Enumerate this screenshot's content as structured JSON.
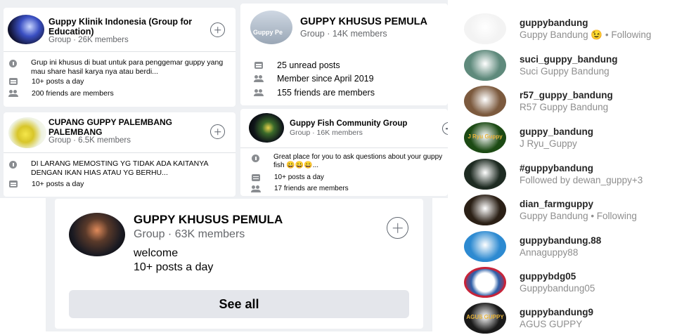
{
  "groups": [
    {
      "title": "Guppy Klinik Indonesia (Group for Education)",
      "subtitle": "Group · 26K members",
      "description": "Grup ini khusus di buat untuk para penggemar guppy yang mau share hasil karya nya atau berdi...",
      "posts": "10+ posts a day",
      "friends": "200 friends are members"
    },
    {
      "title": "GUPPY KHUSUS PEMULA",
      "subtitle": "Group · 14K members",
      "avatar_text": "Guppy Pe",
      "unread": "25 unread posts",
      "member_since": "Member since April 2019",
      "friends": "155 friends are members"
    },
    {
      "title": "CUPANG GUPPY PALEMBANG PALEMBANG",
      "subtitle": "Group · 6.5K members",
      "description": "DI LARANG MEMOSTING YG TIDAK ADA KAITANYA DENGAN IKAN HIAS ATAU YG BERHU...",
      "posts": "10+ posts a day"
    },
    {
      "title": "Guppy Fish Community Group",
      "subtitle": "Group · 16K members",
      "description": "Great place for you to ask questions about your guppy fish 😀😀😀...",
      "posts": "10+ posts a day",
      "friends": "17 friends are members"
    },
    {
      "title": "GUPPY KHUSUS PEMULA",
      "subtitle": "Group · 63K members",
      "description": "welcome",
      "posts": "10+ posts a day"
    }
  ],
  "see_all_label": "See all",
  "instagram_accounts": [
    {
      "username": "guppybandung",
      "name": "Guppy Bandung 😉 • Following",
      "avatar_color": "#f3f3f3"
    },
    {
      "username": "suci_guppy_bandung",
      "name": "Suci Guppy Bandung",
      "avatar_color": "#5f8a7c"
    },
    {
      "username": "r57_guppy_bandung",
      "name": "R57 Guppy Bandung",
      "avatar_color": "#7c5a3e"
    },
    {
      "username": "guppy_bandung",
      "name": "J Ryu_Guppy",
      "avatar_color": "#1c4a14",
      "avatar_text": "J Ryu Guppy"
    },
    {
      "username": "#guppybandung",
      "name": "Followed by dewan_guppy+3",
      "avatar_color": "#1e2b22"
    },
    {
      "username": "dian_farmguppy",
      "name": "Guppy Bandung • Following",
      "avatar_color": "#2b2016"
    },
    {
      "username": "guppybandung.88",
      "name": "Annaguppy88",
      "avatar_color": "#2d8ad1"
    },
    {
      "username": "guppybdg05",
      "name": "Guppybandung05",
      "avatar_color": "#c7243a"
    },
    {
      "username": "guppybandung9",
      "name": "AGUS GUPPY",
      "avatar_color": "#1a1a1a",
      "avatar_text": "AGUS GUPPY"
    }
  ]
}
